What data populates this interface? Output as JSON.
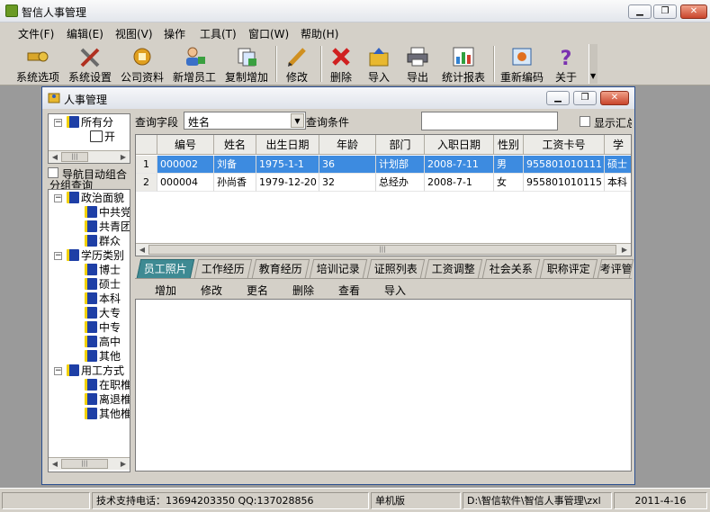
{
  "app": {
    "title": "智信人事管理"
  },
  "window_controls": {
    "minimize": "▁",
    "restore": "❐",
    "close": "✕"
  },
  "menu": [
    "文件(F)",
    "编辑(E)",
    "视图(V)",
    "操作",
    "工具(T)",
    "窗口(W)",
    "帮助(H)"
  ],
  "toolbar": [
    {
      "label": "系统选项",
      "icon": "key-icon"
    },
    {
      "label": "系统设置",
      "icon": "tools-icon"
    },
    {
      "label": "公司资料",
      "icon": "company-icon"
    },
    {
      "label": "新增员工",
      "icon": "add-user-icon"
    },
    {
      "label": "复制增加",
      "icon": "copy-add-icon"
    },
    {
      "label": "修改",
      "icon": "pencil-icon"
    },
    {
      "label": "删除",
      "icon": "delete-x-icon"
    },
    {
      "label": "导入",
      "icon": "import-icon"
    },
    {
      "label": "导出",
      "icon": "export-printer-icon"
    },
    {
      "label": "统计报表",
      "icon": "bar-chart-icon"
    },
    {
      "label": "重新编码",
      "icon": "recode-icon"
    },
    {
      "label": "关于",
      "icon": "help-icon"
    }
  ],
  "child": {
    "title": "人事管理"
  },
  "tree_top": {
    "root": "所有分",
    "child": "开"
  },
  "nav": {
    "checkbox_label_1": "导航目动组合",
    "checkbox_label_2": "分组查询"
  },
  "tree": [
    {
      "label": "政治面貌",
      "children": [
        "中共党",
        "共青团",
        "群众"
      ]
    },
    {
      "label": "学历类别",
      "children": [
        "博士",
        "硕士",
        "本科",
        "大专",
        "中专",
        "高中",
        "其他"
      ]
    },
    {
      "label": "用工方式",
      "children": [
        "在职椎",
        "离退椎",
        "其他椎"
      ]
    }
  ],
  "query": {
    "field_label": "查询字段",
    "field_value": "姓名",
    "condition_label": "查询条件",
    "condition_value": "",
    "summary_label": "显示汇总"
  },
  "grid": {
    "columns": [
      "",
      "编号",
      "姓名",
      "出生日期",
      "年龄",
      "部门",
      "入职日期",
      "性别",
      "工资卡号",
      "学"
    ],
    "rows": [
      {
        "n": "1",
        "cells": [
          "000002",
          "刘备",
          "1975-1-1",
          "36",
          "计划部",
          "2008-7-11",
          "男",
          "955801010111",
          "硕士"
        ]
      },
      {
        "n": "2",
        "cells": [
          "000004",
          "孙尚香",
          "1979-12-20",
          "32",
          "总经办",
          "2008-7-1",
          "女",
          "955801010115",
          "本科"
        ]
      }
    ]
  },
  "tabs": [
    "员工照片",
    "工作经历",
    "教育经历",
    "培训记录",
    "证照列表",
    "工资调整",
    "社会关系",
    "职称评定",
    "考评管"
  ],
  "actions": [
    "增加",
    "修改",
    "更名",
    "删除",
    "查看",
    "导入"
  ],
  "status": {
    "support": "技术支持电话：13694203350 QQ:137028856",
    "edition": "单机版",
    "path": "D:\\智信软件\\智信人事管理\\zxl",
    "date": "2011-4-16"
  }
}
